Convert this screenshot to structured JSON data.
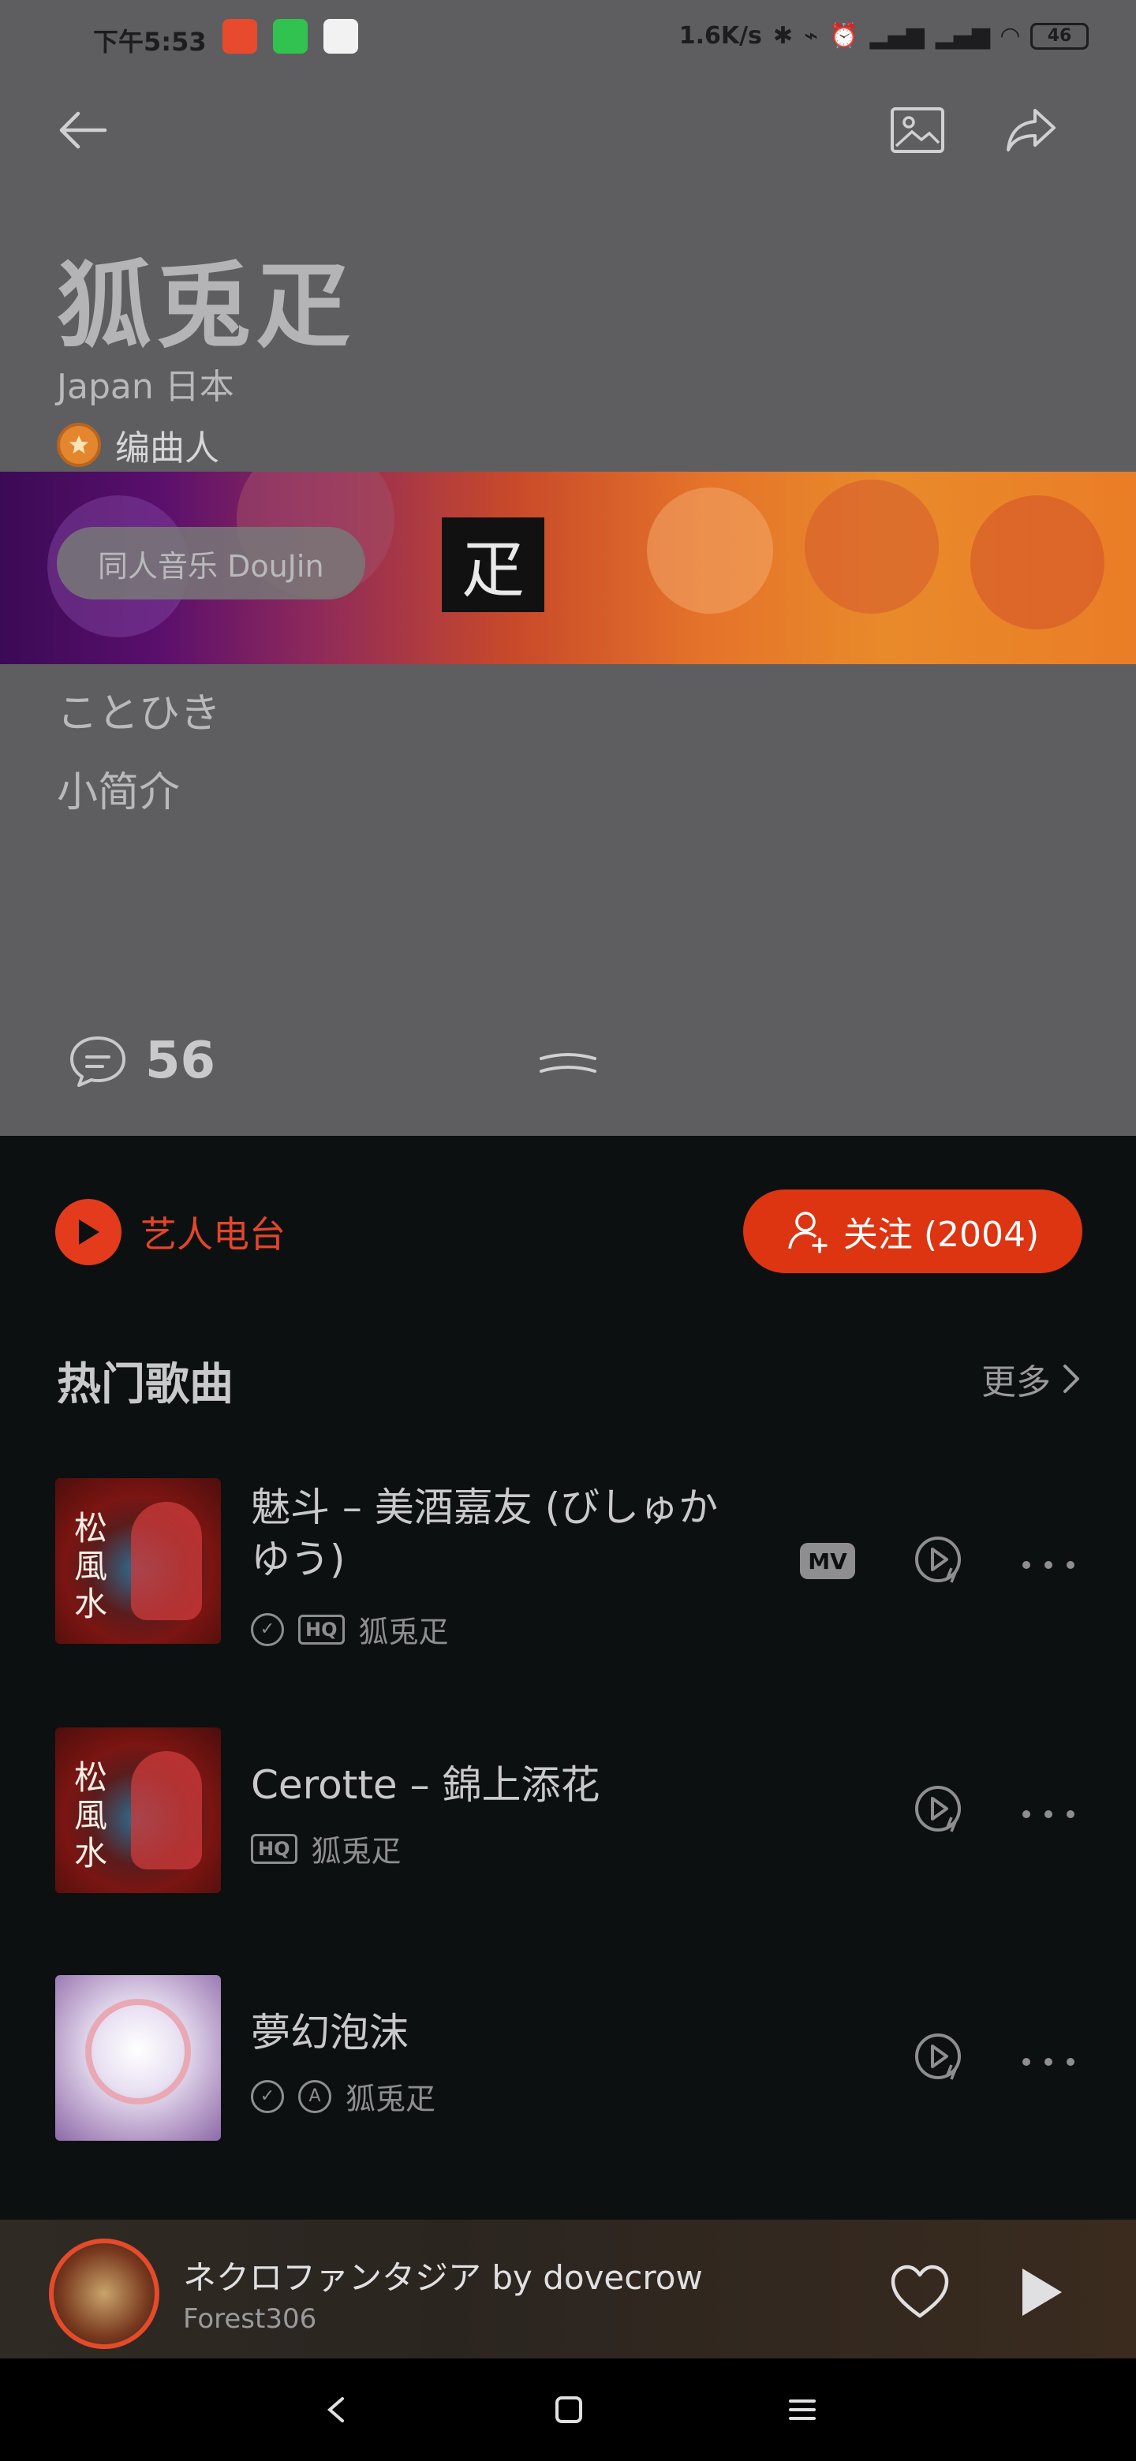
{
  "status_bar": {
    "time": "下午5:53",
    "net_speed": "1.6K/s",
    "signal1": "HD",
    "signal2": "HD",
    "battery": "46"
  },
  "artist": {
    "name": "狐兎疋",
    "region": "Japan 日本",
    "role": "编曲人",
    "genre_tag": "同人音乐 DouJin",
    "alias": "ことひき",
    "intro_label": "小简介",
    "comment_count": "56"
  },
  "actions": {
    "radio_label": "艺人电台",
    "follow_label": "关注 (2004)"
  },
  "hot_songs": {
    "title": "热门歌曲",
    "more_label": "更多",
    "songs": [
      {
        "title": "魅斗 – 美酒嘉友 (びしゅかゆう)",
        "artist": "狐兎疋",
        "tags": [
          "check",
          "HQ"
        ],
        "mv": "MV"
      },
      {
        "title": "Cerotte – 錦上添花",
        "artist": "狐兎疋",
        "tags": [
          "HQ"
        ],
        "mv": ""
      },
      {
        "title": "夢幻泡沫",
        "artist": "狐兎疋",
        "tags": [
          "check",
          "A"
        ],
        "mv": ""
      }
    ]
  },
  "mini_player": {
    "title": "ネクロファンタジア by dovecrow",
    "artist": "Forest306"
  },
  "colors": {
    "accent": "#dd3412",
    "header_bg": "#5e5e60",
    "body_bg": "#0d1011"
  }
}
